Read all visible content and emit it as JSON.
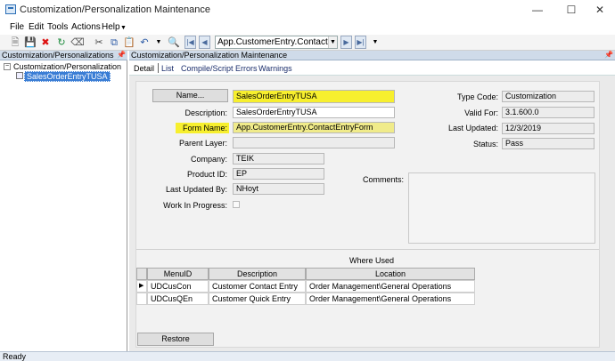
{
  "window": {
    "title": "Customization/Personalization Maintenance",
    "controls": [
      "minimize-icon",
      "maximize-icon",
      "close-icon"
    ]
  },
  "menu": [
    "File",
    "Edit",
    "Tools",
    "Actions",
    "Help"
  ],
  "toolbar": {
    "icons": [
      "new-icon",
      "save-icon",
      "delete-icon",
      "refresh-icon",
      "clear-icon",
      "cut-icon",
      "copy-icon",
      "paste-icon",
      "undo-icon",
      "search-icon",
      "first-icon",
      "prev-icon",
      "next-icon",
      "last-icon"
    ],
    "record_combo": "App.CustomerEntry.ContactEntryf"
  },
  "tree": {
    "header": "Customization/Personalizations",
    "root": "Customization/Personalization",
    "child": "SalesOrderEntryTUSA"
  },
  "main": {
    "header": "Customization/Personalization Maintenance",
    "tabs": [
      {
        "label": "Detail",
        "active": true
      },
      {
        "label": "List",
        "active": false
      },
      {
        "label": "Compile/Script Errors",
        "active": false
      },
      {
        "label": "Warnings",
        "active": false
      }
    ]
  },
  "form": {
    "name_button": "Name...",
    "name_value": "SalesOrderEntryTUSA",
    "description_label": "Description:",
    "description_value": "SalesOrderEntryTUSA",
    "form_name_label": "Form Name:",
    "form_name_value": "App.CustomerEntry.ContactEntryForm",
    "parent_layer_label": "Parent Layer:",
    "parent_layer_value": "",
    "company_label": "Company:",
    "company_value": "TEIK",
    "product_id_label": "Product ID:",
    "product_id_value": "EP",
    "last_updated_by_label": "Last Updated By:",
    "last_updated_by_value": "NHoyt",
    "work_in_progress_label": "Work In Progress:",
    "work_in_progress_checked": false,
    "type_code_label": "Type Code:",
    "type_code_value": "Customization",
    "valid_for_label": "Valid For:",
    "valid_for_value": "3.1.600.0",
    "last_updated_label": "Last Updated:",
    "last_updated_value": "12/3/2019",
    "status_label": "Status:",
    "status_value": "Pass",
    "comments_label": "Comments:",
    "comments_value": ""
  },
  "where_used": {
    "title": "Where Used",
    "columns": [
      "MenuID",
      "Description",
      "Location"
    ],
    "rows": [
      {
        "menu_id": "UDCusCon",
        "description": "Customer Contact Entry",
        "location": "Order Management\\General Operations"
      },
      {
        "menu_id": "UDCusQEn",
        "description": "Customer Quick Entry",
        "location": "Order Management\\General Operations"
      }
    ]
  },
  "restore_button": "Restore",
  "status_bar": "Ready",
  "colors": {
    "highlight": "#f7ef2e",
    "selection": "#3a7dd5",
    "header": "#cfdbe9"
  }
}
